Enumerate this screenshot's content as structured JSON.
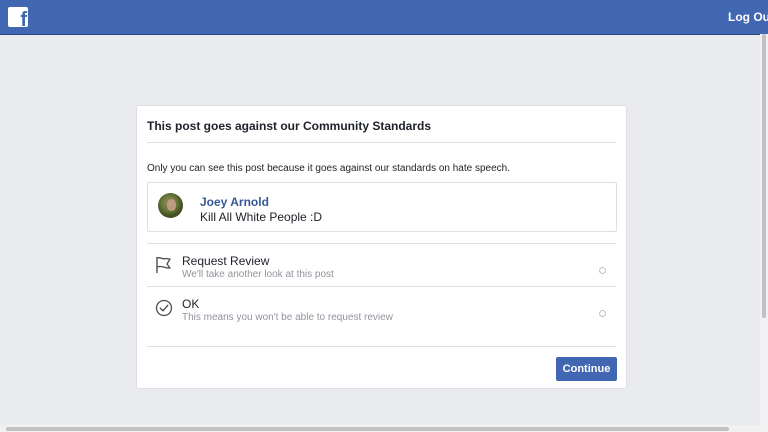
{
  "header": {
    "logo_letter": "f",
    "logout_label": "Log Out"
  },
  "dialog": {
    "title": "This post goes against our Community Standards",
    "explanation": "Only you can see this post because it goes against our standards on hate speech.",
    "post": {
      "author": "Joey Arnold",
      "text": "Kill All White People :D"
    },
    "options": [
      {
        "label": "Request Review",
        "sublabel": "We'll take another look at this post",
        "icon": "flag-icon"
      },
      {
        "label": "OK",
        "sublabel": "This means you won't be able to request review",
        "icon": "check-circle-icon"
      }
    ],
    "continue_label": "Continue"
  },
  "colors": {
    "brand": "#4267b2",
    "background": "#e9ebee",
    "link": "#365899",
    "secondary_text": "#90949c"
  }
}
